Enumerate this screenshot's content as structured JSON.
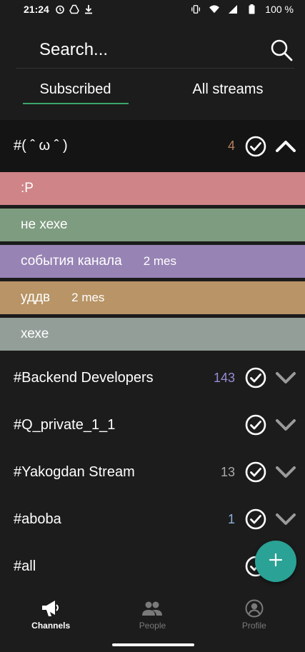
{
  "status_bar": {
    "time": "21:24",
    "battery": "100 %",
    "icons": [
      "alarm-icon",
      "drive-icon",
      "download-icon",
      "vibrate-icon",
      "wifi-icon",
      "signal-icon",
      "battery-icon"
    ]
  },
  "search": {
    "placeholder": "Search...",
    "icon": "search-icon"
  },
  "tabs": [
    {
      "label": "Subscribed",
      "active": true
    },
    {
      "label": "All streams",
      "active": false
    }
  ],
  "streams": [
    {
      "name": "#( ˆ ω ˆ )",
      "count": "4",
      "count_color": "#b97e5e",
      "expanded": true,
      "topics": [
        {
          "name": ":P",
          "count": "",
          "color": "#cf8487"
        },
        {
          "name": "не хехе",
          "count": "",
          "color": "#7e9c80"
        },
        {
          "name": "события канала",
          "count": "2 mes",
          "color": "#9783b4"
        },
        {
          "name": "уддв",
          "count": "2 mes",
          "color": "#b89466"
        },
        {
          "name": "хехе",
          "count": "",
          "color": "#939e98"
        }
      ]
    },
    {
      "name": "#Backend Developers",
      "count": "143",
      "count_color": "#9a8bd6",
      "expanded": false
    },
    {
      "name": "#Q_private_1_1",
      "count": "",
      "count_color": "#aaaaaa",
      "expanded": false
    },
    {
      "name": "#Yakogdan Stream",
      "count": "13",
      "count_color": "#aaaaaa",
      "expanded": false
    },
    {
      "name": "#aboba",
      "count": "1",
      "count_color": "#8ab3d8",
      "expanded": false
    },
    {
      "name": "#all",
      "count": "",
      "count_color": "#aaaaaa",
      "expanded": false
    }
  ],
  "bottom_nav": [
    {
      "label": "Channels",
      "icon": "megaphone-icon",
      "active": true
    },
    {
      "label": "People",
      "icon": "people-icon",
      "active": false
    },
    {
      "label": "Profile",
      "icon": "profile-icon",
      "active": false
    }
  ],
  "fab": {
    "icon": "plus-icon",
    "color": "#2aa295"
  },
  "colors": {
    "accent": "#3aa66c",
    "background": "#1c1c1c"
  }
}
